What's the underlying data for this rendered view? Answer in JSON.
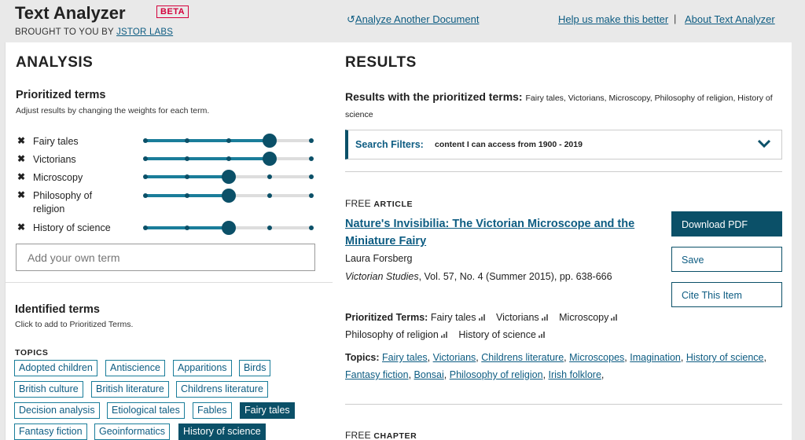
{
  "header": {
    "brand": "Text Analyzer",
    "badge": "BETA",
    "byline_prefix": "BROUGHT TO YOU BY ",
    "byline_link": "JSTOR LABS",
    "analyze_another": "Analyze Another Document",
    "help_link": "Help us make this better",
    "separator": "|",
    "about_link": "About Text Analyzer"
  },
  "analysis": {
    "heading": "ANALYSIS",
    "prioritized_title": "Prioritized terms",
    "prioritized_hint": "Adjust results by changing the weights for each term.",
    "terms": [
      {
        "label": "Fairy tales",
        "weight": 4
      },
      {
        "label": "Victorians",
        "weight": 4
      },
      {
        "label": "Microscopy",
        "weight": 3
      },
      {
        "label": "Philosophy of religion",
        "weight": 3
      },
      {
        "label": "History of science",
        "weight": 3
      }
    ],
    "slider_steps": 5,
    "add_placeholder": "Add your own term",
    "identified_title": "Identified terms",
    "identified_hint": "Click to add to Prioritized Terms.",
    "topics_label": "TOPICS",
    "topics": [
      {
        "label": "Adopted children",
        "selected": false
      },
      {
        "label": "Antiscience",
        "selected": false
      },
      {
        "label": "Apparitions",
        "selected": false
      },
      {
        "label": "Birds",
        "selected": false
      },
      {
        "label": "British culture",
        "selected": false
      },
      {
        "label": "British literature",
        "selected": false
      },
      {
        "label": "Childrens literature",
        "selected": false
      },
      {
        "label": "Decision analysis",
        "selected": false
      },
      {
        "label": "Etiological tales",
        "selected": false
      },
      {
        "label": "Fables",
        "selected": false
      },
      {
        "label": "Fairy tales",
        "selected": true
      },
      {
        "label": "Fantasy fiction",
        "selected": false
      },
      {
        "label": "Geoinformatics",
        "selected": false
      },
      {
        "label": "History of science",
        "selected": true
      }
    ]
  },
  "results": {
    "heading": "RESULTS",
    "query_label": "Results with the prioritized terms:",
    "query_terms": "Fairy tales, Victorians, Microscopy, Philosophy of religion, History of science",
    "filters_label": "Search Filters:",
    "filters_value": "content I can access from 1900 - 2019",
    "article": {
      "access": "FREE",
      "type": "ARTICLE",
      "title": "Nature's Invisibilia: The Victorian Microscope and the Miniature Fairy",
      "author": "Laura Forsberg",
      "journal": "Victorian Studies",
      "citation": ", Vol. 57, No. 4 (Summer 2015), pp. 638-666",
      "download_label": "Download PDF",
      "save_label": "Save",
      "cite_label": "Cite This Item",
      "prioritized_label": "Prioritized Terms:",
      "prioritized_terms": [
        "Fairy tales",
        "Victorians",
        "Microscopy",
        "Philosophy of religion",
        "History of science"
      ],
      "topics_label": "Topics:",
      "topics": [
        "Fairy tales",
        "Victorians",
        "Childrens literature",
        "Microscopes",
        "Imagination",
        "History of science",
        "Fantasy fiction",
        "Bonsai",
        "Philosophy of religion",
        "Irish folklore"
      ]
    },
    "next": {
      "access": "FREE",
      "type": "CHAPTER"
    }
  },
  "colors": {
    "accent": "#0b5068",
    "link": "#0d5c82",
    "badge": "#d4003c"
  }
}
